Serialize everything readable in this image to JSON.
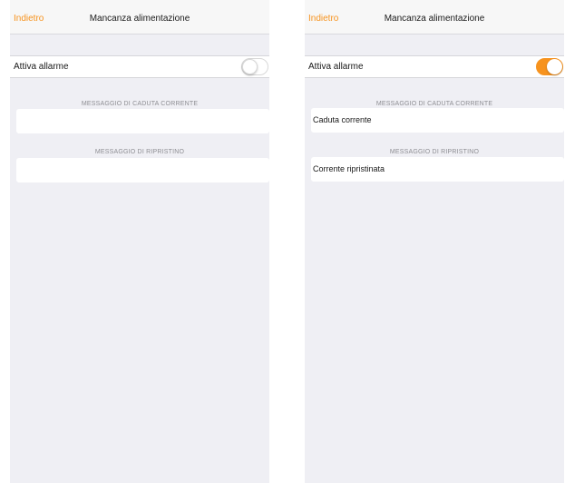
{
  "screens": [
    {
      "nav": {
        "back_label": "Indietro",
        "title": "Mancanza alimentazione"
      },
      "alarm_row": {
        "label": "Attiva allarme",
        "toggle_on": false
      },
      "fault_message": {
        "header": "MESSAGGIO DI CADUTA CORRENTE",
        "value": ""
      },
      "restore_message": {
        "header": "MESSAGGIO DI RIPRISTINO",
        "value": ""
      }
    },
    {
      "nav": {
        "back_label": "Indietro",
        "title": "Mancanza alimentazione"
      },
      "alarm_row": {
        "label": "Attiva allarme",
        "toggle_on": true
      },
      "fault_message": {
        "header": "MESSAGGIO DI CADUTA CORRENTE",
        "value": "Caduta corrente"
      },
      "restore_message": {
        "header": "MESSAGGIO DI RIPRISTINO",
        "value": "Corrente ripristinata"
      }
    }
  ],
  "colors": {
    "accent": "#f7931e",
    "background": "#efeff4",
    "secondary_text": "#8e8e93"
  }
}
